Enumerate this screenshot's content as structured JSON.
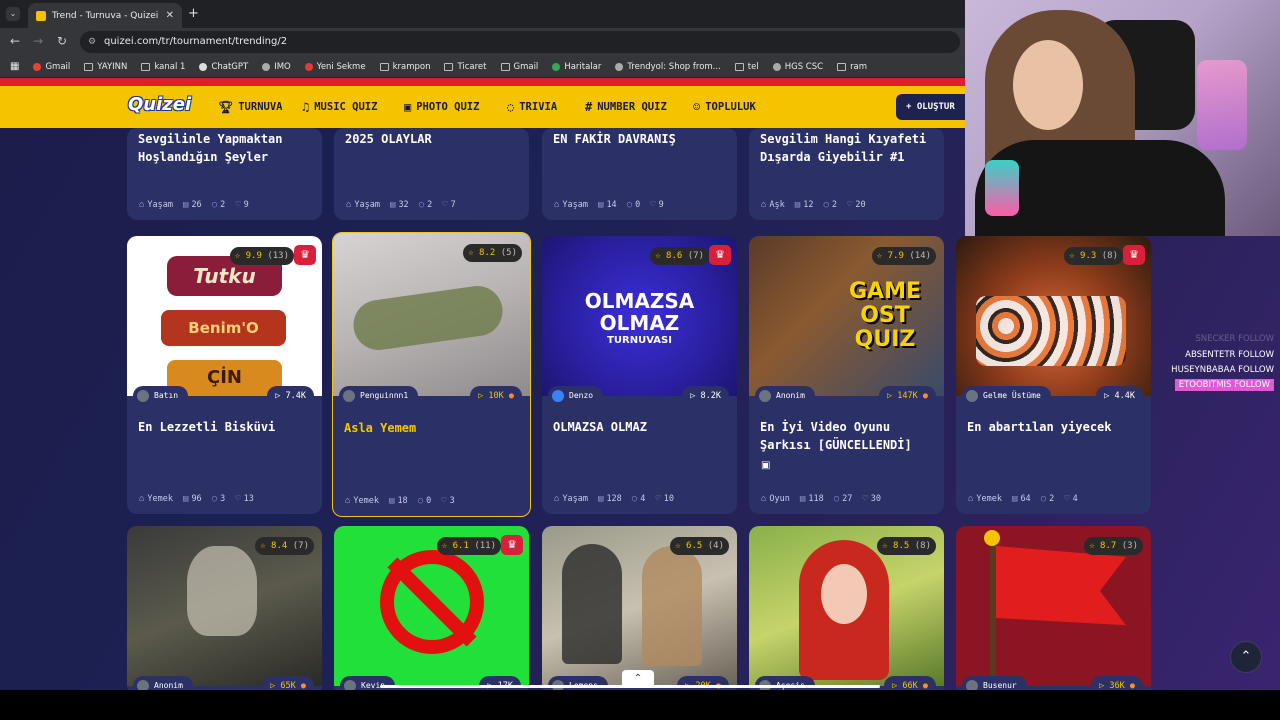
{
  "browser": {
    "tab_title": "Trend - Turnuva - Quizei",
    "url": "quizei.com/tr/tournament/trending/2",
    "bookmarks": [
      "Gmail",
      "YAYINN",
      "kanal 1",
      "ChatGPT",
      "IMO",
      "Yeni Sekme",
      "krampon",
      "Ticaret",
      "Gmail",
      "Haritalar",
      "Trendyol: Shop from...",
      "tel",
      "HGS CSC",
      "ram"
    ]
  },
  "site": {
    "logo": "Quizei",
    "nav": [
      "TURNUVA",
      "MUSIC QUIZ",
      "PHOTO QUIZ",
      "TRIVIA",
      "NUMBER QUIZ",
      "TOPLULUK"
    ],
    "create_button": "+ OLUŞTUR"
  },
  "top_row": [
    {
      "title": "Sevgilinle Yapmaktan Hoşlandığın Şeyler",
      "category": "Yaşam",
      "items": "26",
      "comments": "2",
      "likes": "9"
    },
    {
      "title": "2025 OLAYLAR",
      "category": "Yaşam",
      "items": "32",
      "comments": "2",
      "likes": "7"
    },
    {
      "title": "EN FAKİR DAVRANIŞ",
      "category": "Yaşam",
      "items": "14",
      "comments": "0",
      "likes": "9"
    },
    {
      "title": "Sevgilim Hangi Kıyafeti Dışarda Giyebilir #1",
      "category": "Aşk",
      "items": "12",
      "comments": "2",
      "likes": "20"
    }
  ],
  "mid_row": [
    {
      "rating": "9.9",
      "votes": "(13)",
      "author": "Batın",
      "plays": "7.4K",
      "title": "En Lezzetli Bisküvi",
      "category": "Yemek",
      "items": "96",
      "comments": "3",
      "likes": "13"
    },
    {
      "rating": "8.2",
      "votes": "(5)",
      "author": "Penguinnn1",
      "plays": "10K",
      "title": "Asla Yemem",
      "category": "Yemek",
      "items": "18",
      "comments": "0",
      "likes": "3"
    },
    {
      "rating": "8.6",
      "votes": "(7)",
      "author": "Denzo",
      "plays": "8.2K",
      "title": "OLMAZSA OLMAZ",
      "category": "Yaşam",
      "items": "128",
      "comments": "4",
      "likes": "10",
      "thumb_text": [
        "OLMAZSA",
        "OLMAZ",
        "TURNUVASI"
      ]
    },
    {
      "rating": "7.9",
      "votes": "(14)",
      "author": "Anonim",
      "plays": "147K",
      "title": "En İyi Video Oyunu Şarkısı [GÜNCELLENDİ]",
      "category": "Oyun",
      "items": "118",
      "comments": "27",
      "likes": "30",
      "thumb_text": [
        "GAME",
        "OST",
        "QUIZ"
      ]
    },
    {
      "rating": "9.3",
      "votes": "(8)",
      "author": "Gelme Üstüme",
      "plays": "4.4K",
      "title": "En abartılan yiyecek",
      "category": "Yemek",
      "items": "64",
      "comments": "2",
      "likes": "4"
    }
  ],
  "bottom_row": [
    {
      "rating": "8.4",
      "votes": "(7)",
      "author": "Anonim",
      "plays": "65K"
    },
    {
      "rating": "6.1",
      "votes": "(11)",
      "author": "Kevin",
      "plays": "17K"
    },
    {
      "rating": "6.5",
      "votes": "(4)",
      "author": "Lemens",
      "plays": "20K"
    },
    {
      "rating": "8.5",
      "votes": "(8)",
      "author": "Aşosis",
      "plays": "66K"
    },
    {
      "rating": "8.7",
      "votes": "(3)",
      "author": "Busenur",
      "plays": "36K"
    }
  ],
  "stream_chat": [
    {
      "name": "SNECKER",
      "action": "FOLLOW"
    },
    {
      "name": "ABSENTETR",
      "action": "FOLLOW"
    },
    {
      "name": "HUSEYNBABAA",
      "action": "FOLLOW"
    },
    {
      "name": "ETOOBITMIS",
      "action": "FOLLOW"
    }
  ]
}
